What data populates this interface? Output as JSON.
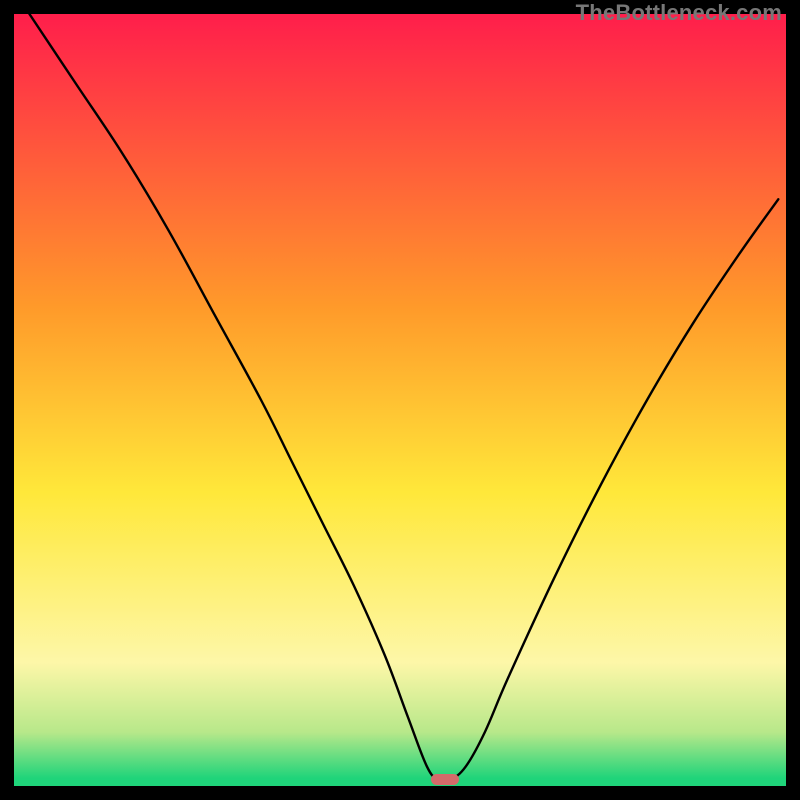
{
  "watermark": "TheBottleneck.com",
  "colors": {
    "frame": "#000000",
    "grad_top": "#ff1e4b",
    "grad_orange": "#ff9a2a",
    "grad_yellow": "#ffe83a",
    "grad_pale": "#fdf7a8",
    "grad_band": "#b8e88a",
    "grad_green": "#1fd47a",
    "curve": "#000000",
    "marker": "#d46a6a"
  },
  "chart_data": {
    "type": "line",
    "title": "",
    "xlabel": "",
    "ylabel": "",
    "xlim": [
      0,
      100
    ],
    "ylim": [
      0,
      100
    ],
    "series": [
      {
        "name": "bottleneck-curve",
        "x": [
          2,
          8,
          14,
          20,
          26,
          32,
          36,
          40,
          44,
          48,
          51,
          53.5,
          55,
          56.5,
          58.5,
          61,
          64,
          70,
          76,
          82,
          88,
          94,
          99
        ],
        "values": [
          100,
          91,
          82,
          72,
          61,
          50,
          42,
          34,
          26,
          17,
          9,
          2.5,
          0.8,
          0.8,
          2.5,
          7,
          14,
          27,
          39,
          50,
          60,
          69,
          76
        ]
      }
    ],
    "marker": {
      "x_center": 55.8,
      "width_pct": 3.6,
      "y": 0.9
    },
    "gradient_stops": [
      {
        "pct": 0,
        "color": "#ff1e4b"
      },
      {
        "pct": 38,
        "color": "#ff9a2a"
      },
      {
        "pct": 62,
        "color": "#ffe83a"
      },
      {
        "pct": 84,
        "color": "#fdf7a8"
      },
      {
        "pct": 93,
        "color": "#b8e88a"
      },
      {
        "pct": 99,
        "color": "#1fd47a"
      },
      {
        "pct": 100,
        "color": "#1fd47a"
      }
    ]
  }
}
